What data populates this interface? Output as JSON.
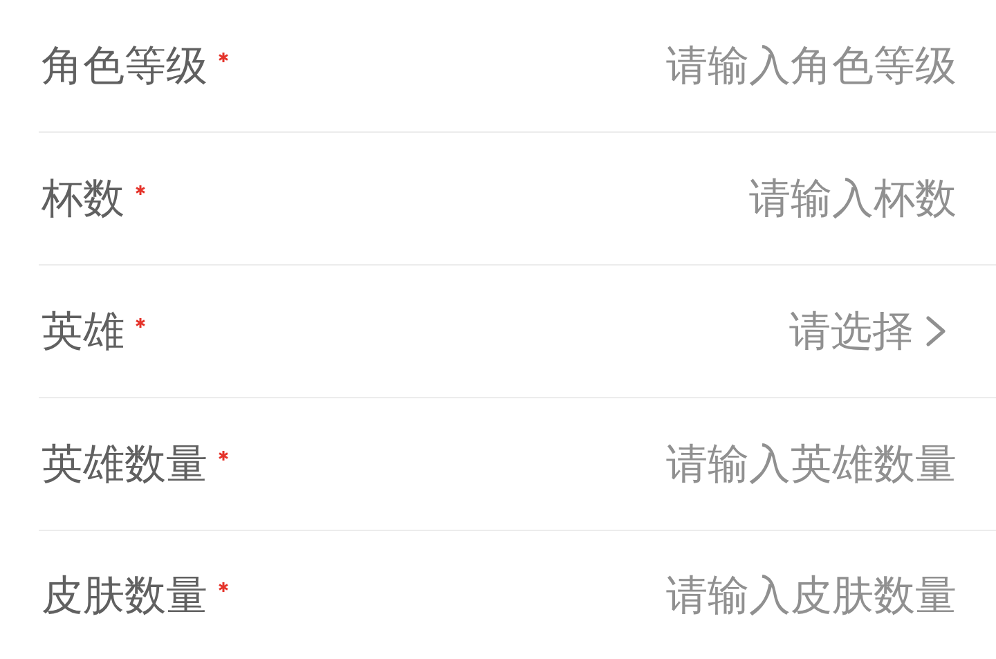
{
  "form": {
    "rows": [
      {
        "kind": "input",
        "label": "角色等级",
        "required": true,
        "placeholder": "请输入角色等级"
      },
      {
        "kind": "input",
        "label": "杯数",
        "required": true,
        "placeholder": "请输入杯数"
      },
      {
        "kind": "select",
        "label": "英雄",
        "required": true,
        "placeholder": "请选择"
      },
      {
        "kind": "input",
        "label": "英雄数量",
        "required": true,
        "placeholder": "请输入英雄数量"
      },
      {
        "kind": "input",
        "label": "皮肤数量",
        "required": true,
        "placeholder": "请输入皮肤数量"
      }
    ]
  }
}
